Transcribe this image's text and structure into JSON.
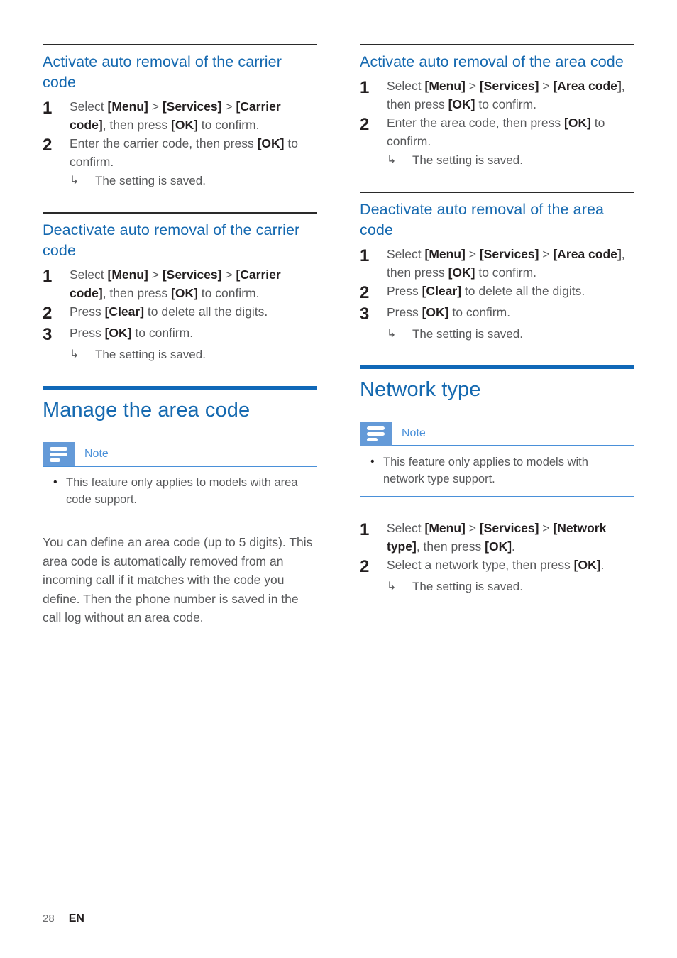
{
  "page": {
    "number": "28",
    "language": "EN"
  },
  "note_icon_name": "note-lines-icon",
  "colors": {
    "heading_blue": "#1569b0",
    "rule_blue": "#1068b8",
    "note_blue": "#4a90d9",
    "note_icon_bg": "#649ad8",
    "body_text": "#58595b",
    "strong_text": "#231f20"
  },
  "left_column": {
    "sections": [
      {
        "id": "activate-carrier-code",
        "rule": "thin",
        "heading": "Activate auto removal of the carrier code",
        "steps": [
          {
            "number": "1",
            "parts": [
              {
                "t": "Select ",
                "b": false
              },
              {
                "t": "[Menu]",
                "b": true
              },
              {
                "t": " > ",
                "b": false
              },
              {
                "t": "[Services]",
                "b": true
              },
              {
                "t": " > ",
                "b": false
              },
              {
                "t": "[Carrier code]",
                "b": true
              },
              {
                "t": ", then press ",
                "b": false
              },
              {
                "t": "[OK]",
                "b": true
              },
              {
                "t": " to confirm.",
                "b": false
              }
            ]
          },
          {
            "number": "2",
            "parts": [
              {
                "t": "Enter the carrier code, then press ",
                "b": false
              },
              {
                "t": "[OK]",
                "b": true
              },
              {
                "t": " to confirm.",
                "b": false
              }
            ],
            "result": "The setting is saved."
          }
        ]
      },
      {
        "id": "deactivate-carrier-code",
        "rule": "thin",
        "heading": "Deactivate auto removal of the carrier code",
        "steps": [
          {
            "number": "1",
            "parts": [
              {
                "t": "Select ",
                "b": false
              },
              {
                "t": "[Menu]",
                "b": true
              },
              {
                "t": " > ",
                "b": false
              },
              {
                "t": "[Services]",
                "b": true
              },
              {
                "t": " > ",
                "b": false
              },
              {
                "t": "[Carrier code]",
                "b": true
              },
              {
                "t": ", then press ",
                "b": false
              },
              {
                "t": "[OK]",
                "b": true
              },
              {
                "t": " to confirm.",
                "b": false
              }
            ]
          },
          {
            "number": "2",
            "parts": [
              {
                "t": "Press ",
                "b": false
              },
              {
                "t": "[Clear]",
                "b": true
              },
              {
                "t": " to delete all the digits.",
                "b": false
              }
            ]
          },
          {
            "number": "3",
            "parts": [
              {
                "t": "Press ",
                "b": false
              },
              {
                "t": "[OK]",
                "b": true
              },
              {
                "t": " to confirm.",
                "b": false
              }
            ],
            "result": "The setting is saved."
          }
        ]
      },
      {
        "id": "manage-the-area-code",
        "rule": "thick",
        "main_heading": "Manage the area code",
        "note": {
          "label": "Note",
          "items": [
            "This feature only applies to models with area code support."
          ]
        },
        "paragraph": "You can define an area code (up to 5 digits). This area code is automatically removed from an incoming call if it matches with the code you define. Then the phone number is saved in the call log without an area code."
      }
    ]
  },
  "right_column": {
    "sections": [
      {
        "id": "activate-area-code",
        "rule": "thin",
        "heading": "Activate auto removal of the area code",
        "steps": [
          {
            "number": "1",
            "parts": [
              {
                "t": "Select ",
                "b": false
              },
              {
                "t": "[Menu]",
                "b": true
              },
              {
                "t": " > ",
                "b": false
              },
              {
                "t": "[Services]",
                "b": true
              },
              {
                "t": " > ",
                "b": false
              },
              {
                "t": "[Area code]",
                "b": true
              },
              {
                "t": ", then press ",
                "b": false
              },
              {
                "t": "[OK]",
                "b": true
              },
              {
                "t": " to confirm.",
                "b": false
              }
            ]
          },
          {
            "number": "2",
            "parts": [
              {
                "t": "Enter the area code, then press ",
                "b": false
              },
              {
                "t": "[OK]",
                "b": true
              },
              {
                "t": " to confirm.",
                "b": false
              }
            ],
            "result": "The setting is saved."
          }
        ]
      },
      {
        "id": "deactivate-area-code",
        "rule": "thin",
        "heading": "Deactivate auto removal of the area code",
        "steps": [
          {
            "number": "1",
            "parts": [
              {
                "t": "Select ",
                "b": false
              },
              {
                "t": "[Menu]",
                "b": true
              },
              {
                "t": " > ",
                "b": false
              },
              {
                "t": "[Services]",
                "b": true
              },
              {
                "t": " > ",
                "b": false
              },
              {
                "t": "[Area code]",
                "b": true
              },
              {
                "t": ", then press ",
                "b": false
              },
              {
                "t": "[OK]",
                "b": true
              },
              {
                "t": " to confirm.",
                "b": false
              }
            ]
          },
          {
            "number": "2",
            "parts": [
              {
                "t": "Press ",
                "b": false
              },
              {
                "t": "[Clear]",
                "b": true
              },
              {
                "t": " to delete all the digits.",
                "b": false
              }
            ]
          },
          {
            "number": "3",
            "parts": [
              {
                "t": "Press ",
                "b": false
              },
              {
                "t": "[OK]",
                "b": true
              },
              {
                "t": " to confirm.",
                "b": false
              }
            ],
            "result": "The setting is saved."
          }
        ]
      },
      {
        "id": "network-type",
        "rule": "thick",
        "main_heading": "Network type",
        "note": {
          "label": "Note",
          "items": [
            "This feature only applies to models with network type support."
          ]
        },
        "steps": [
          {
            "number": "1",
            "parts": [
              {
                "t": "Select ",
                "b": false
              },
              {
                "t": "[Menu]",
                "b": true
              },
              {
                "t": " > ",
                "b": false
              },
              {
                "t": "[Services]",
                "b": true
              },
              {
                "t": " > ",
                "b": false
              },
              {
                "t": "[Network type]",
                "b": true
              },
              {
                "t": ", then press ",
                "b": false
              },
              {
                "t": "[OK]",
                "b": true
              },
              {
                "t": ".",
                "b": false
              }
            ]
          },
          {
            "number": "2",
            "parts": [
              {
                "t": "Select a network type, then press ",
                "b": false
              },
              {
                "t": "[OK]",
                "b": true
              },
              {
                "t": ".",
                "b": false
              }
            ],
            "result": "The setting is saved."
          }
        ]
      }
    ]
  }
}
